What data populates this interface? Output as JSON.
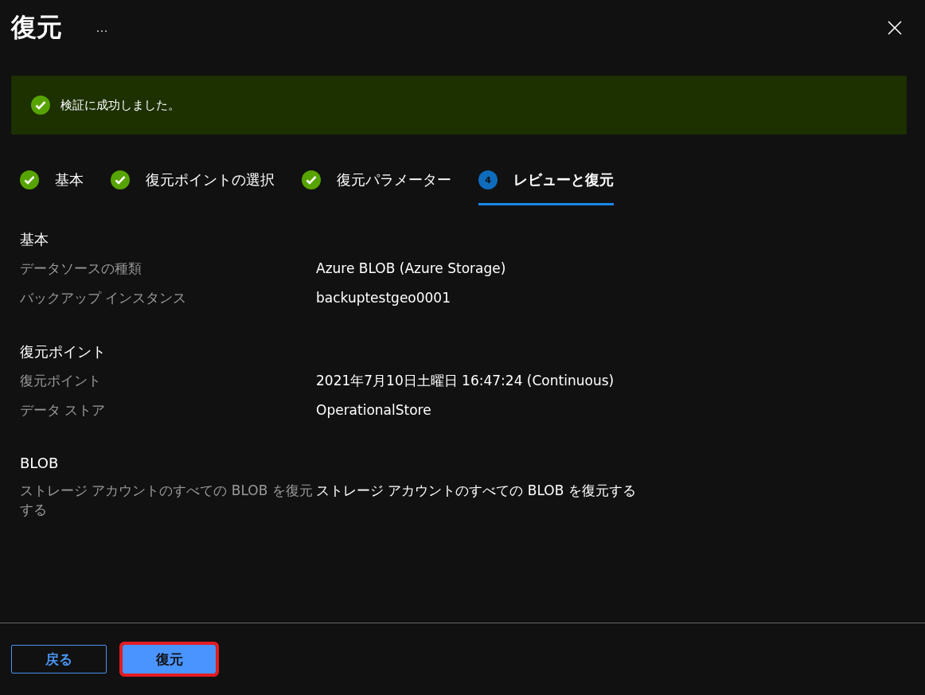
{
  "header": {
    "title": "復元",
    "more": "…"
  },
  "banner": {
    "message": "検証に成功しました。"
  },
  "steps": [
    {
      "kind": "done",
      "label": "基本",
      "selected": false
    },
    {
      "kind": "done",
      "label": "復元ポイントの選択",
      "selected": false
    },
    {
      "kind": "done",
      "label": "復元パラメーター",
      "selected": false
    },
    {
      "kind": "number",
      "number": "4",
      "label": "レビューと復元",
      "selected": true
    }
  ],
  "sections": [
    {
      "title": "基本",
      "rows": [
        {
          "label": "データソースの種類",
          "value": "Azure BLOB (Azure Storage)"
        },
        {
          "label": "バックアップ インスタンス",
          "value": "backuptestgeo0001"
        }
      ]
    },
    {
      "title": "復元ポイント",
      "rows": [
        {
          "label": "復元ポイント",
          "value": "2021年7月10日土曜日 16:47:24 (Continuous)"
        },
        {
          "label": "データ ストア",
          "value": "OperationalStore"
        }
      ]
    },
    {
      "title": "BLOB",
      "rows": [
        {
          "label": "ストレージ アカウントのすべての BLOB を復元する",
          "value": "ストレージ アカウントのすべての BLOB を復元する"
        }
      ]
    }
  ],
  "footer": {
    "buttons": [
      {
        "kind": "secondary",
        "label": "戻る",
        "highlighted": false
      },
      {
        "kind": "primary",
        "label": "復元",
        "highlighted": true
      }
    ]
  }
}
